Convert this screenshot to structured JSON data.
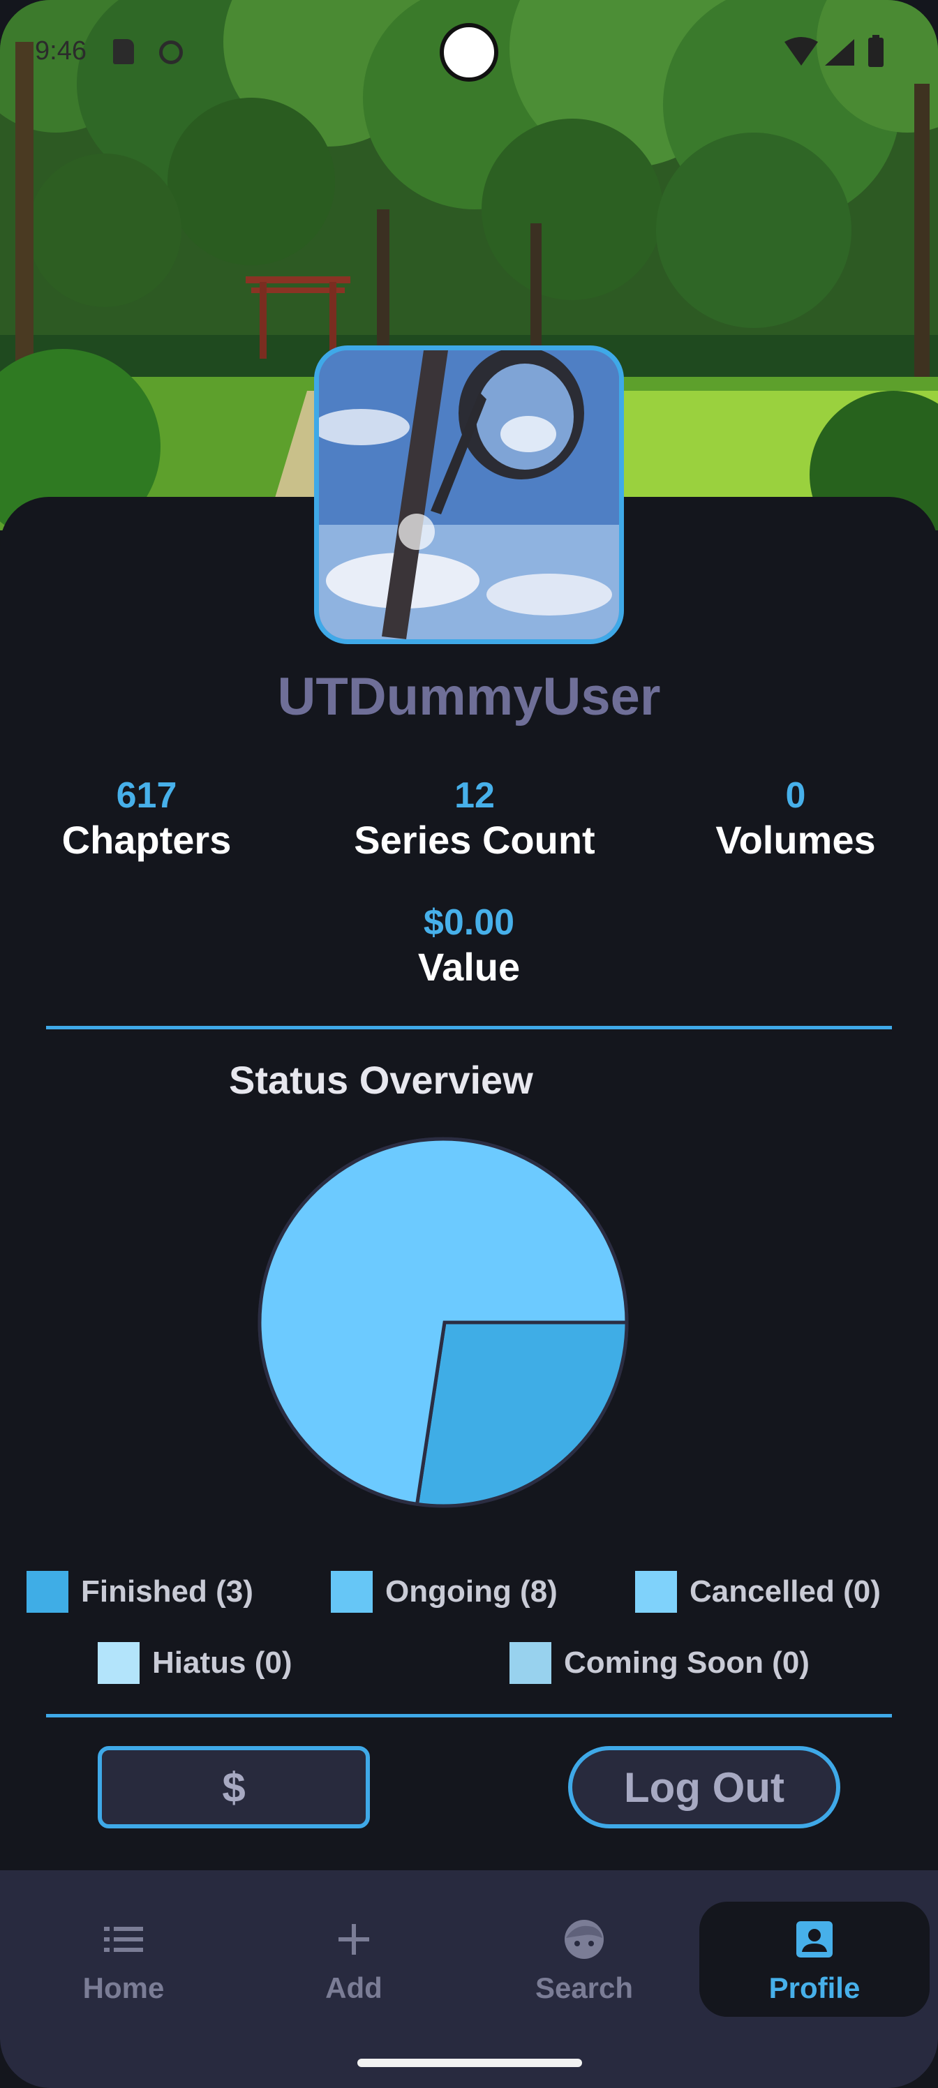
{
  "status_bar": {
    "time": "9:46"
  },
  "profile": {
    "username": "UTDummyUser"
  },
  "stats": [
    {
      "value": "617",
      "label": "Chapters"
    },
    {
      "value": "12",
      "label": "Series Count"
    },
    {
      "value": "0",
      "label": "Volumes"
    },
    {
      "value": "$0.00",
      "label": "Value"
    }
  ],
  "status_overview": {
    "title": "Status Overview",
    "legend": [
      {
        "label": "Finished (3)",
        "color": "#3fade6"
      },
      {
        "label": "Ongoing (8)",
        "color": "#66c6f6"
      },
      {
        "label": "Cancelled (0)",
        "color": "#7fd2fb"
      },
      {
        "label": "Hiatus (0)",
        "color": "#b3e4fb"
      },
      {
        "label": "Coming Soon (0)",
        "color": "#98d2ee"
      }
    ]
  },
  "chart_data": {
    "type": "pie",
    "title": "Status Overview",
    "categories": [
      "Finished",
      "Ongoing",
      "Cancelled",
      "Hiatus",
      "Coming Soon"
    ],
    "values": [
      3,
      8,
      0,
      0,
      0
    ],
    "colors": [
      "#3fade6",
      "#6ccaff",
      "#7fd2fb",
      "#b3e4fb",
      "#98d2ee"
    ]
  },
  "actions": {
    "dollar_label": "$",
    "logout_label": "Log Out"
  },
  "nav": {
    "items": [
      {
        "label": "Home",
        "icon": "list-icon"
      },
      {
        "label": "Add",
        "icon": "plus-icon"
      },
      {
        "label": "Search",
        "icon": "face-icon"
      },
      {
        "label": "Profile",
        "icon": "profile-icon"
      }
    ],
    "active": "Profile"
  },
  "colors": {
    "accent": "#3fa9e8",
    "background": "#14161d",
    "nav_background": "#282a3f"
  }
}
